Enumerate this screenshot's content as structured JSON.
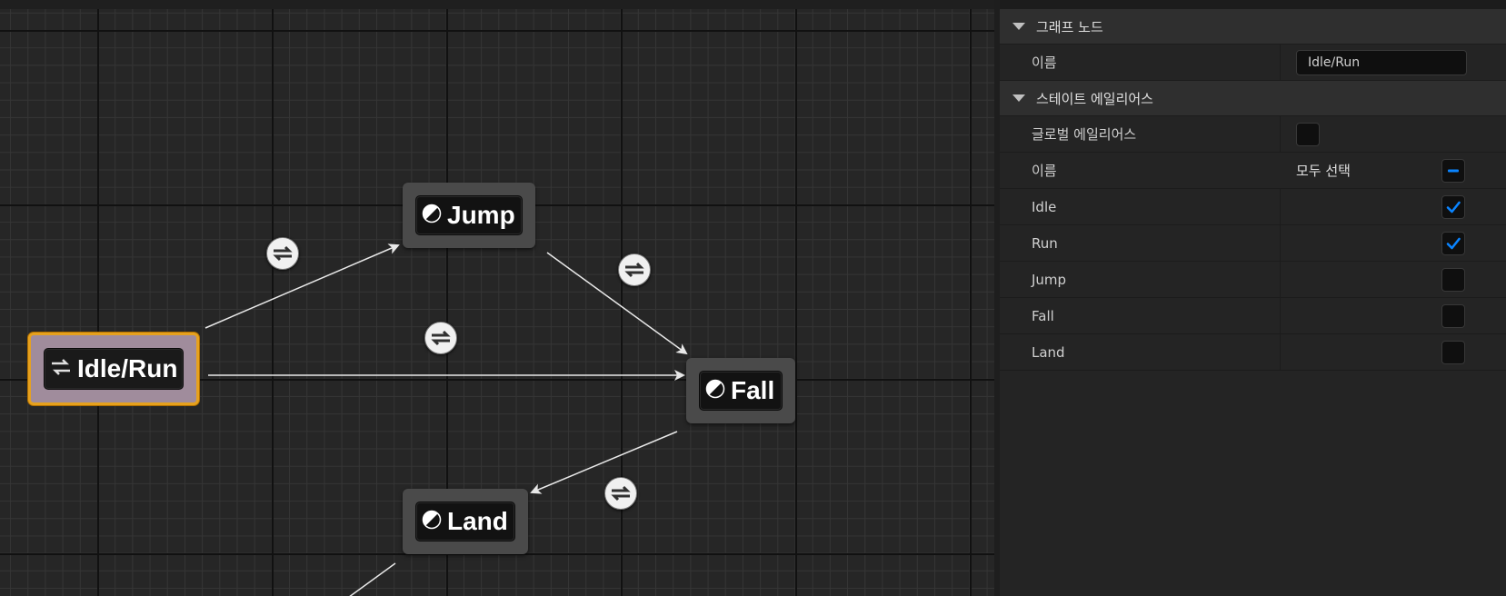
{
  "graph": {
    "states": [
      {
        "id": "idle-run",
        "label": "Idle/Run",
        "icon": "transition-arrows-icon",
        "selected": true
      },
      {
        "id": "jump",
        "label": "Jump",
        "icon": "state-half-circle-icon",
        "selected": false
      },
      {
        "id": "fall",
        "label": "Fall",
        "icon": "state-half-circle-icon",
        "selected": false
      },
      {
        "id": "land",
        "label": "Land",
        "icon": "state-half-circle-icon",
        "selected": false
      }
    ],
    "transitions": [
      {
        "from": "Idle/Run",
        "to": "Jump"
      },
      {
        "from": "Jump",
        "to": "Fall"
      },
      {
        "from": "Idle/Run",
        "to": "Fall"
      },
      {
        "from": "Fall",
        "to": "Land"
      },
      {
        "from": "Land",
        "to": ""
      }
    ],
    "colors": {
      "selected_border": "#e6a11e",
      "selected_fill": "#a08c9c",
      "node_fill": "#4a4a4a",
      "wire": "#e8e8e8"
    }
  },
  "details": {
    "graph_node_section": {
      "title": "그래프 노드",
      "name_label": "이름",
      "name_value": "Idle/Run"
    },
    "state_alias_section": {
      "title": "스테이트 에일리어스",
      "global_alias_label": "글로벌 에일리어스",
      "global_alias_checked": false,
      "list_header_name": "이름",
      "select_all_label": "모두 선택",
      "select_all_state": "indeterminate",
      "states": [
        {
          "name": "Idle",
          "checked": true
        },
        {
          "name": "Run",
          "checked": true
        },
        {
          "name": "Jump",
          "checked": false
        },
        {
          "name": "Fall",
          "checked": false
        },
        {
          "name": "Land",
          "checked": false
        }
      ]
    },
    "colors": {
      "accent": "#0a84ff"
    }
  }
}
